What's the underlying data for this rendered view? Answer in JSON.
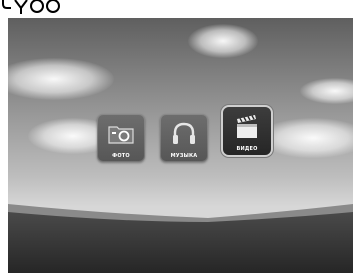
{
  "menu": {
    "items": [
      {
        "label": "ФОТО",
        "icon": "photo-folder-icon",
        "selected": false
      },
      {
        "label": "МУЗЫКА",
        "icon": "headphones-icon",
        "selected": false
      },
      {
        "label": "ВИДЕО",
        "icon": "clapperboard-icon",
        "selected": true
      }
    ]
  },
  "colors": {
    "sky_top": "#5f5f5f",
    "horizon": "#d7d7d7",
    "ground": "#2e2e2e",
    "tile": "#5e5e5e",
    "tile_selected": "#2b2b2b"
  }
}
